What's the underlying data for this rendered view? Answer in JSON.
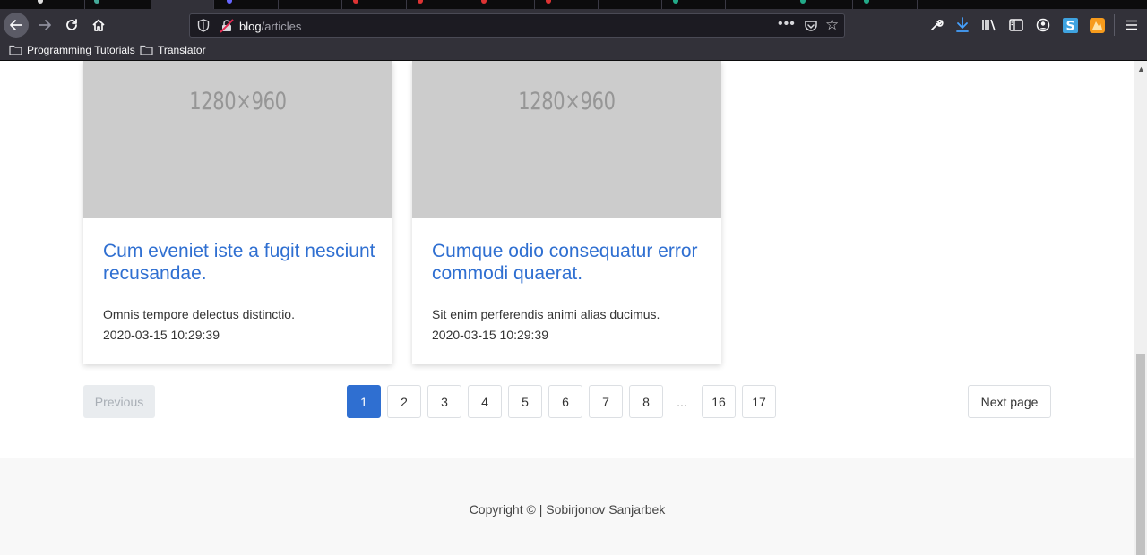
{
  "browser": {
    "url_host": "blog",
    "url_path": "/articles",
    "bookmarks": [
      "Programming Tutorials",
      "Translator"
    ]
  },
  "articles": [
    {
      "image_label": "1280×960",
      "title": "Cum eveniet iste a fugit nesciunt recusandae.",
      "excerpt": "Omnis tempore delectus distinctio.",
      "date": "2020-03-15 10:29:39"
    },
    {
      "image_label": "1280×960",
      "title": "Cumque odio consequatur error commodi quaerat.",
      "excerpt": "Sit enim perferendis animi alias ducimus.",
      "date": "2020-03-15 10:29:39"
    }
  ],
  "pagination": {
    "previous_label": "Previous",
    "next_label": "Next page",
    "pages": [
      "1",
      "2",
      "3",
      "4",
      "5",
      "6",
      "7",
      "8",
      "...",
      "16",
      "17"
    ],
    "current_page": "1"
  },
  "footer": {
    "copyright": "Copyright © | Sobirjonov Sanjarbek"
  },
  "colors": {
    "link": "#2f6fd1",
    "active_page": "#2f6fd1",
    "placeholder": "#cccccc",
    "footer_bg": "#f8f8f8"
  },
  "icons": [
    "back-arrow-icon",
    "forward-arrow-icon",
    "reload-icon",
    "home-icon",
    "tracking-shield-icon",
    "insecure-lock-icon",
    "page-actions-icon",
    "pocket-icon",
    "bookmark-star-icon",
    "wrench-icon",
    "download-icon",
    "library-icon",
    "sidebar-icon",
    "account-icon",
    "extension-s-icon",
    "extension-fox-icon",
    "menu-icon",
    "folder-icon"
  ]
}
